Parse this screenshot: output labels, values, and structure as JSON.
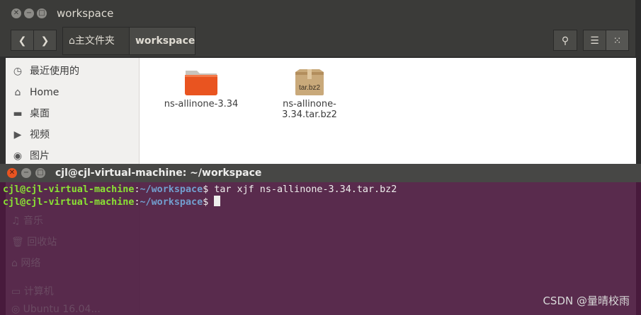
{
  "files_window": {
    "title": "workspace",
    "breadcrumbs": [
      "主文件夹",
      "workspace"
    ],
    "sidebar": [
      {
        "icon": "clock-icon",
        "label": "最近使用的"
      },
      {
        "icon": "home-icon",
        "label": "Home"
      },
      {
        "icon": "desktop-icon",
        "label": "桌面"
      },
      {
        "icon": "video-icon",
        "label": "视频"
      },
      {
        "icon": "camera-icon",
        "label": "图片"
      }
    ],
    "hidden_sidebar": [
      "音乐",
      "回收站",
      "网络",
      "计算机",
      "Ubuntu 16.04..."
    ],
    "files": [
      {
        "name": "ns-allinone-3.34",
        "type": "folder",
        "icon_color": "#e95420"
      },
      {
        "name": "ns-allinone-3.34.tar.bz2",
        "type": "archive",
        "badge": "tar.bz2"
      }
    ]
  },
  "terminal_window": {
    "title": "cjl@cjl-virtual-machine: ~/workspace",
    "lines": [
      {
        "user": "cjl@cjl-virtual-machine",
        "path": "~/workspace",
        "prompt": "$ ",
        "cmd": "tar xjf ns-allinone-3.34.tar.bz2"
      },
      {
        "user": "cjl@cjl-virtual-machine",
        "path": "~/workspace",
        "prompt": "$ ",
        "cmd": ""
      }
    ]
  },
  "watermark": "CSDN @量晴校雨"
}
